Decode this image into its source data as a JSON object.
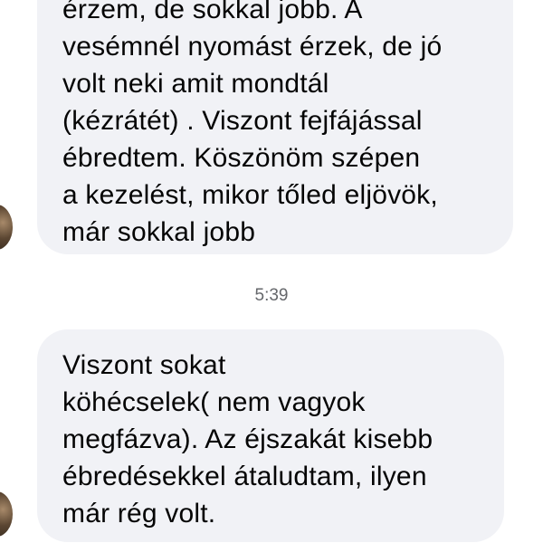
{
  "messages": [
    {
      "lines": [
        "érzem,  de sokkal jobb. A",
        "vesémnél nyomást érzek, de jó",
        "volt neki amit mondtál",
        "(kézrátét) . Viszont fejfájással",
        "ébredtem. Köszönöm szépen",
        "a kezelést,  mikor tőled eljövök,",
        "már sokkal jobb"
      ]
    },
    {
      "lines": [
        "Viszont sokat",
        "köhécselek( nem vagyok",
        "megfázva). Az éjszakát kisebb",
        "ébredésekkel átaludtam,  ilyen",
        "már rég volt."
      ]
    }
  ],
  "timestamp": "5:39"
}
